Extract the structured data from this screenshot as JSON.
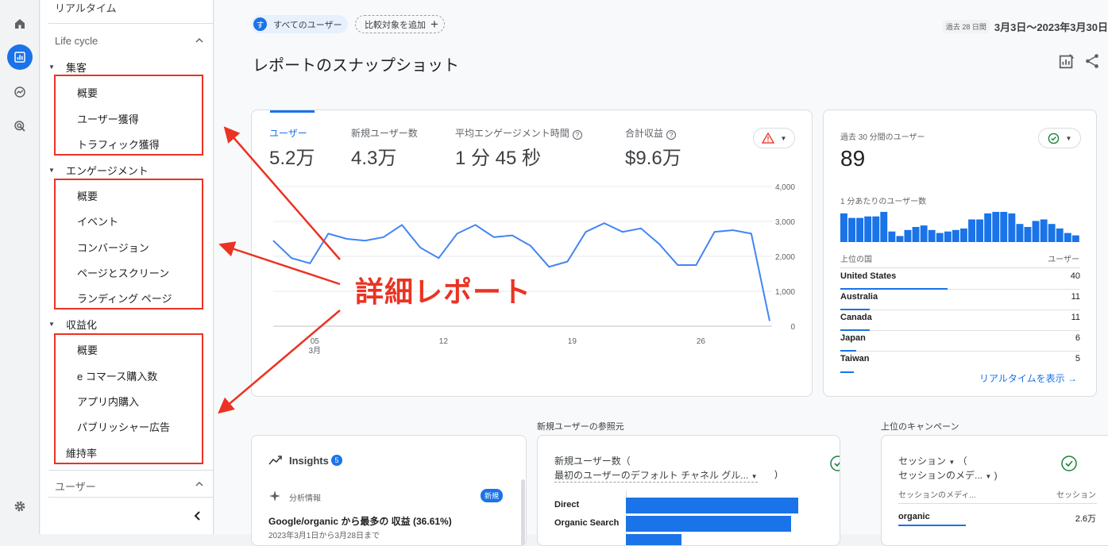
{
  "rail": {
    "icons": [
      "home-icon",
      "reports-icon",
      "explore-icon",
      "advertising-icon",
      "settings-icon"
    ]
  },
  "sidenav": {
    "realtime": "リアルタイム",
    "lifecycle": "Life cycle",
    "acquisition": {
      "label": "集客",
      "items": [
        "概要",
        "ユーザー獲得",
        "トラフィック獲得"
      ]
    },
    "engagement": {
      "label": "エンゲージメント",
      "items": [
        "概要",
        "イベント",
        "コンバージョン",
        "ページとスクリーン",
        "ランディング ページ"
      ]
    },
    "monetization": {
      "label": "収益化",
      "items": [
        "概要",
        "e コマース購入数",
        "アプリ内購入",
        "パブリッシャー広告"
      ]
    },
    "retention": "維持率",
    "user_section": "ユーザー"
  },
  "header": {
    "segment_avatar": "す",
    "segment": "すべてのユーザー",
    "add_comparison": "比較対象を追加",
    "range_pill": "過去 28 日間",
    "date_range": "3月3日～2023年3月30日",
    "title": "レポートのスナップショット"
  },
  "metrics": [
    {
      "label": "ユーザー",
      "value": "5.2万"
    },
    {
      "label": "新規ユーザー数",
      "value": "4.3万"
    },
    {
      "label": "平均エンゲージメント時間",
      "value": "1 分 45 秒"
    },
    {
      "label": "合計収益",
      "value": "$9.6万"
    }
  ],
  "chart_data": {
    "type": "line",
    "ylim": [
      0,
      4000
    ],
    "y_ticks": [
      "4,000",
      "3,000",
      "2,000",
      "1,000",
      "0"
    ],
    "x_ticks": [
      {
        "label": "05",
        "sub": "3月"
      },
      {
        "label": "12",
        "sub": ""
      },
      {
        "label": "19",
        "sub": ""
      },
      {
        "label": "26",
        "sub": ""
      }
    ],
    "x": [
      3,
      4,
      5,
      6,
      7,
      8,
      9,
      10,
      11,
      12,
      13,
      14,
      15,
      16,
      17,
      18,
      19,
      20,
      21,
      22,
      23,
      24,
      25,
      26,
      27,
      28,
      29,
      30
    ],
    "values": [
      2450,
      1950,
      1800,
      2650,
      2500,
      2450,
      2550,
      2900,
      2250,
      1950,
      2650,
      2900,
      2550,
      2600,
      2300,
      1700,
      1850,
      2700,
      2950,
      2700,
      2800,
      2350,
      1750,
      1750,
      2700,
      2750,
      2650,
      150
    ]
  },
  "realtime": {
    "label": "過去 30 分間のユーザー",
    "value": "89",
    "per_minute": "1 分あたりのユーザー数",
    "per_minute_bars": [
      0.95,
      0.8,
      0.8,
      0.85,
      0.85,
      1.0,
      0.35,
      0.2,
      0.4,
      0.5,
      0.55,
      0.4,
      0.3,
      0.35,
      0.4,
      0.45,
      0.75,
      0.75,
      0.95,
      1.0,
      1.0,
      0.95,
      0.6,
      0.5,
      0.7,
      0.75,
      0.6,
      0.45,
      0.3,
      0.22
    ],
    "col_country": "上位の国",
    "col_users": "ユーザー",
    "countries": [
      {
        "name": "United States",
        "users": "40"
      },
      {
        "name": "Australia",
        "users": "11"
      },
      {
        "name": "Canada",
        "users": "11"
      },
      {
        "name": "Japan",
        "users": "6"
      },
      {
        "name": "Taiwan",
        "users": "5"
      }
    ],
    "view_link": "リアルタイムを表示"
  },
  "bottom": {
    "insights": {
      "title": "Insights",
      "badge": "5",
      "sub": "分析情報",
      "new_badge": "新規",
      "headline": "Google/organic から最多の 収益 (36.61%)",
      "subline": "2023年3月1日から3月28日まで"
    },
    "referral": {
      "section": "新規ユーザーの参照元",
      "metric": "新規ユーザー数（",
      "dim": "最初のユーザーのデフォルト チャネル グル...",
      "close": ")",
      "rows": [
        {
          "name": "Direct",
          "value": 0.97
        },
        {
          "name": "Organic Search",
          "value": 0.93
        }
      ]
    },
    "campaign": {
      "section": "上位のキャンペーン",
      "metric": "セッション",
      "metric_paren": "（",
      "dim": "セッションのメデ...",
      "close": ")",
      "col1": "セッションのメディ...",
      "col2": "セッション",
      "rows": [
        {
          "name": "organic",
          "value": "2.6万"
        }
      ]
    }
  },
  "annotation": "詳細レポート",
  "colors": {
    "accent": "#1a73e8",
    "annotation": "#ea3323",
    "line": "#4285f4"
  }
}
